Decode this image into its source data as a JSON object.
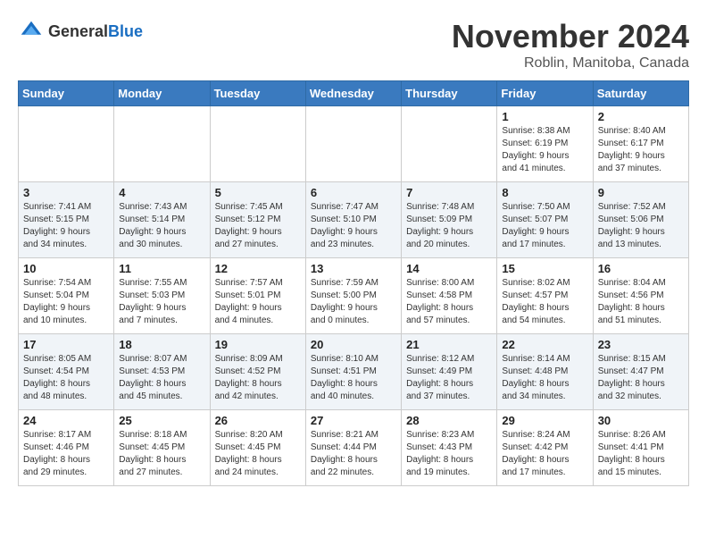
{
  "logo": {
    "general": "General",
    "blue": "Blue"
  },
  "title": "November 2024",
  "location": "Roblin, Manitoba, Canada",
  "days_of_week": [
    "Sunday",
    "Monday",
    "Tuesday",
    "Wednesday",
    "Thursday",
    "Friday",
    "Saturday"
  ],
  "weeks": [
    [
      {
        "day": "",
        "info": ""
      },
      {
        "day": "",
        "info": ""
      },
      {
        "day": "",
        "info": ""
      },
      {
        "day": "",
        "info": ""
      },
      {
        "day": "",
        "info": ""
      },
      {
        "day": "1",
        "info": "Sunrise: 8:38 AM\nSunset: 6:19 PM\nDaylight: 9 hours\nand 41 minutes."
      },
      {
        "day": "2",
        "info": "Sunrise: 8:40 AM\nSunset: 6:17 PM\nDaylight: 9 hours\nand 37 minutes."
      }
    ],
    [
      {
        "day": "3",
        "info": "Sunrise: 7:41 AM\nSunset: 5:15 PM\nDaylight: 9 hours\nand 34 minutes."
      },
      {
        "day": "4",
        "info": "Sunrise: 7:43 AM\nSunset: 5:14 PM\nDaylight: 9 hours\nand 30 minutes."
      },
      {
        "day": "5",
        "info": "Sunrise: 7:45 AM\nSunset: 5:12 PM\nDaylight: 9 hours\nand 27 minutes."
      },
      {
        "day": "6",
        "info": "Sunrise: 7:47 AM\nSunset: 5:10 PM\nDaylight: 9 hours\nand 23 minutes."
      },
      {
        "day": "7",
        "info": "Sunrise: 7:48 AM\nSunset: 5:09 PM\nDaylight: 9 hours\nand 20 minutes."
      },
      {
        "day": "8",
        "info": "Sunrise: 7:50 AM\nSunset: 5:07 PM\nDaylight: 9 hours\nand 17 minutes."
      },
      {
        "day": "9",
        "info": "Sunrise: 7:52 AM\nSunset: 5:06 PM\nDaylight: 9 hours\nand 13 minutes."
      }
    ],
    [
      {
        "day": "10",
        "info": "Sunrise: 7:54 AM\nSunset: 5:04 PM\nDaylight: 9 hours\nand 10 minutes."
      },
      {
        "day": "11",
        "info": "Sunrise: 7:55 AM\nSunset: 5:03 PM\nDaylight: 9 hours\nand 7 minutes."
      },
      {
        "day": "12",
        "info": "Sunrise: 7:57 AM\nSunset: 5:01 PM\nDaylight: 9 hours\nand 4 minutes."
      },
      {
        "day": "13",
        "info": "Sunrise: 7:59 AM\nSunset: 5:00 PM\nDaylight: 9 hours\nand 0 minutes."
      },
      {
        "day": "14",
        "info": "Sunrise: 8:00 AM\nSunset: 4:58 PM\nDaylight: 8 hours\nand 57 minutes."
      },
      {
        "day": "15",
        "info": "Sunrise: 8:02 AM\nSunset: 4:57 PM\nDaylight: 8 hours\nand 54 minutes."
      },
      {
        "day": "16",
        "info": "Sunrise: 8:04 AM\nSunset: 4:56 PM\nDaylight: 8 hours\nand 51 minutes."
      }
    ],
    [
      {
        "day": "17",
        "info": "Sunrise: 8:05 AM\nSunset: 4:54 PM\nDaylight: 8 hours\nand 48 minutes."
      },
      {
        "day": "18",
        "info": "Sunrise: 8:07 AM\nSunset: 4:53 PM\nDaylight: 8 hours\nand 45 minutes."
      },
      {
        "day": "19",
        "info": "Sunrise: 8:09 AM\nSunset: 4:52 PM\nDaylight: 8 hours\nand 42 minutes."
      },
      {
        "day": "20",
        "info": "Sunrise: 8:10 AM\nSunset: 4:51 PM\nDaylight: 8 hours\nand 40 minutes."
      },
      {
        "day": "21",
        "info": "Sunrise: 8:12 AM\nSunset: 4:49 PM\nDaylight: 8 hours\nand 37 minutes."
      },
      {
        "day": "22",
        "info": "Sunrise: 8:14 AM\nSunset: 4:48 PM\nDaylight: 8 hours\nand 34 minutes."
      },
      {
        "day": "23",
        "info": "Sunrise: 8:15 AM\nSunset: 4:47 PM\nDaylight: 8 hours\nand 32 minutes."
      }
    ],
    [
      {
        "day": "24",
        "info": "Sunrise: 8:17 AM\nSunset: 4:46 PM\nDaylight: 8 hours\nand 29 minutes."
      },
      {
        "day": "25",
        "info": "Sunrise: 8:18 AM\nSunset: 4:45 PM\nDaylight: 8 hours\nand 27 minutes."
      },
      {
        "day": "26",
        "info": "Sunrise: 8:20 AM\nSunset: 4:45 PM\nDaylight: 8 hours\nand 24 minutes."
      },
      {
        "day": "27",
        "info": "Sunrise: 8:21 AM\nSunset: 4:44 PM\nDaylight: 8 hours\nand 22 minutes."
      },
      {
        "day": "28",
        "info": "Sunrise: 8:23 AM\nSunset: 4:43 PM\nDaylight: 8 hours\nand 19 minutes."
      },
      {
        "day": "29",
        "info": "Sunrise: 8:24 AM\nSunset: 4:42 PM\nDaylight: 8 hours\nand 17 minutes."
      },
      {
        "day": "30",
        "info": "Sunrise: 8:26 AM\nSunset: 4:41 PM\nDaylight: 8 hours\nand 15 minutes."
      }
    ]
  ]
}
